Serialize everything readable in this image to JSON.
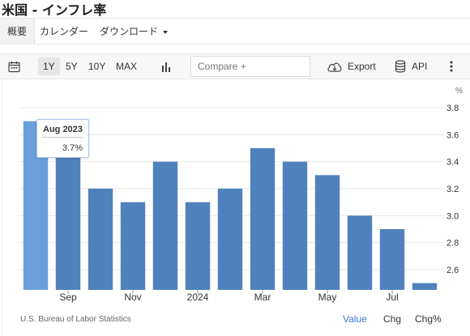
{
  "page": {
    "title": "米国 - インフレ率"
  },
  "tabs": [
    {
      "label": "概要",
      "active": true
    },
    {
      "label": "カレンダー",
      "active": false
    },
    {
      "label": "ダウンロード",
      "active": false
    }
  ],
  "toolbar": {
    "ranges": [
      {
        "label": "1Y",
        "active": true
      },
      {
        "label": "5Y",
        "active": false
      },
      {
        "label": "10Y",
        "active": false
      },
      {
        "label": "MAX",
        "active": false
      }
    ],
    "compare_placeholder": "Compare +",
    "export_label": "Export",
    "api_label": "API",
    "icons": [
      "calendar-icon",
      "bar-chart-icon",
      "download-cloud-icon",
      "database-icon",
      "more-vertical-icon"
    ]
  },
  "chart_data": {
    "type": "bar",
    "unit_label": "%",
    "categories": [
      "Aug 2023",
      "Sep 2023",
      "Oct 2023",
      "Nov 2023",
      "Dec 2023",
      "Jan 2024",
      "Feb 2024",
      "Mar 2024",
      "Apr 2024",
      "May 2024",
      "Jun 2024",
      "Jul 2024",
      "Aug 2024"
    ],
    "values": [
      3.7,
      3.7,
      3.2,
      3.1,
      3.4,
      3.1,
      3.2,
      3.5,
      3.4,
      3.3,
      3.0,
      2.9,
      2.5
    ],
    "highlight_index": 0,
    "x_tick_labels": [
      {
        "index": 1,
        "label": "Sep"
      },
      {
        "index": 3,
        "label": "Nov"
      },
      {
        "index": 5,
        "label": "2024"
      },
      {
        "index": 7,
        "label": "Mar"
      },
      {
        "index": 9,
        "label": "May"
      },
      {
        "index": 11,
        "label": "Jul"
      }
    ],
    "y_ticks": [
      "3.8",
      "3.6",
      "3.4",
      "3.2",
      "3.0",
      "2.8",
      "2.6"
    ],
    "ylim": [
      2.45,
      3.87
    ],
    "grid": true,
    "bar_color": "#4f81bd",
    "highlight_color": "#6a9fdb"
  },
  "tooltip": {
    "date": "Aug 2023",
    "value": "3.7%"
  },
  "footer": {
    "source": "U.S. Bureau of Labor Statistics",
    "buttons": [
      {
        "label": "Value",
        "active": true
      },
      {
        "label": "Chg",
        "active": false
      },
      {
        "label": "Chg%",
        "active": false
      }
    ]
  }
}
